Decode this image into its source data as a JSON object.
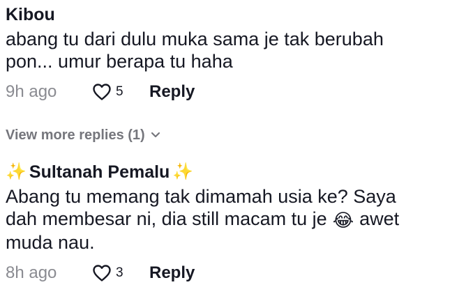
{
  "comments": [
    {
      "username": "Kibou",
      "text": "abang tu dari dulu muka sama je tak berubah\npon... umur berapa tu haha",
      "time": "9h ago",
      "likes": "5",
      "reply_label": "Reply"
    },
    {
      "username": "Sultanah Pemalu",
      "username_decoration": "✨",
      "text_part1": "Abang tu memang tak dimamah usia ke? Saya\ndah membesar ni, dia still macam tu je",
      "emoji": "😂",
      "text_part2": "awet\nmuda nau.",
      "time": "8h ago",
      "likes": "3",
      "reply_label": "Reply"
    }
  ],
  "view_more": {
    "label": "View more replies (1)"
  },
  "icons": {
    "like": "heart-outline-icon",
    "expand": "chevron-down-icon"
  },
  "colors": {
    "text": "#161823",
    "muted": "#8a8b91"
  }
}
